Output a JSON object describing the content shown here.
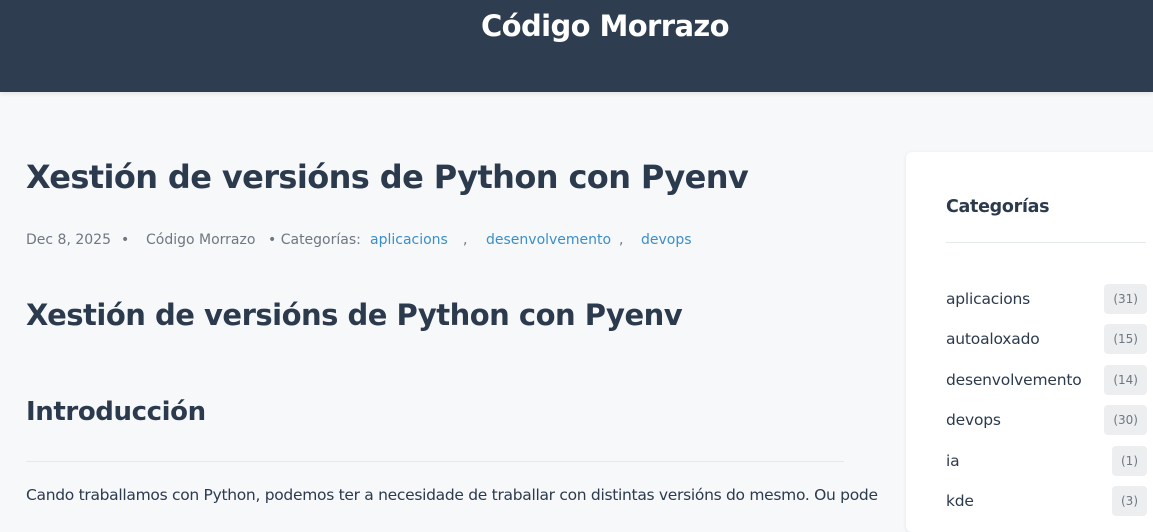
{
  "site": {
    "title": "Código Morrazo"
  },
  "post": {
    "title": "Xestión de versións de Python con Pyenv",
    "date": "Dec 8, 2025",
    "bullet": "•",
    "author": "Código Morrazo",
    "categories_label": "• Categorías:",
    "categories": [
      "aplicacions",
      "desenvolvemento",
      "devops"
    ],
    "separator": ",",
    "heading1": "Xestión de versións de Python con Pyenv",
    "heading2": "Introducción",
    "paragraph": "Cando traballamos con Python, podemos ter a necesidade de traballar con distintas versións do mesmo. Ou pode"
  },
  "sidebar": {
    "title": "Categorías",
    "items": [
      {
        "name": "aplicacions",
        "count": "(31)"
      },
      {
        "name": "autoaloxado",
        "count": "(15)"
      },
      {
        "name": "desenvolvemento",
        "count": "(14)"
      },
      {
        "name": "devops",
        "count": "(30)"
      },
      {
        "name": "ia",
        "count": "(1)"
      },
      {
        "name": "kde",
        "count": "(3)"
      }
    ]
  },
  "colors": {
    "header_bg": "#2e3d50",
    "link": "#3a8fc8",
    "text": "#2c3a4e",
    "page_bg": "#f7f8fa"
  }
}
